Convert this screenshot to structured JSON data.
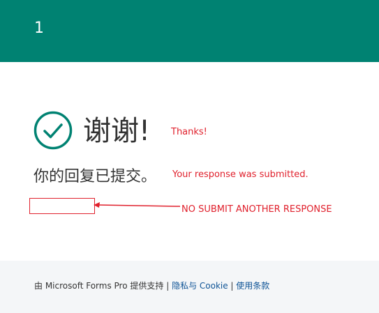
{
  "header": {
    "title": "1",
    "color": "#008272"
  },
  "main": {
    "heading": "谢谢!",
    "message": "你的回复已提交。",
    "check_icon": "checkmark-circle-icon",
    "check_color": "#008272"
  },
  "annotations": {
    "thanks": "Thanks!",
    "response": "Your response was submitted.",
    "no_submit": "NO SUBMIT ANOTHER RESPONSE",
    "color": "#e0202c"
  },
  "footer": {
    "prefix": "由 Microsoft Forms Pro 提供支持",
    "separator_1": " | ",
    "privacy_link": "隐私与 Cookie",
    "separator_2": " | ",
    "terms_link": "使用条款",
    "link_color": "#0f5496"
  }
}
